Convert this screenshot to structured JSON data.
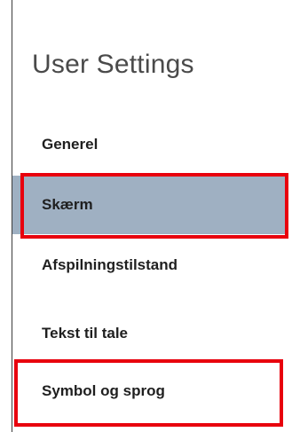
{
  "settings_panel": {
    "title": "User Settings",
    "items": [
      {
        "label": "Generel",
        "active": false
      },
      {
        "label": "Skærm",
        "active": true
      },
      {
        "label": "Afspilningstilstand",
        "active": false
      },
      {
        "label": "Tekst til tale",
        "active": false
      },
      {
        "label": "Symbol og sprog",
        "active": false
      }
    ],
    "active_color": "#9fb0c2",
    "highlight_color": "#e8000d"
  }
}
